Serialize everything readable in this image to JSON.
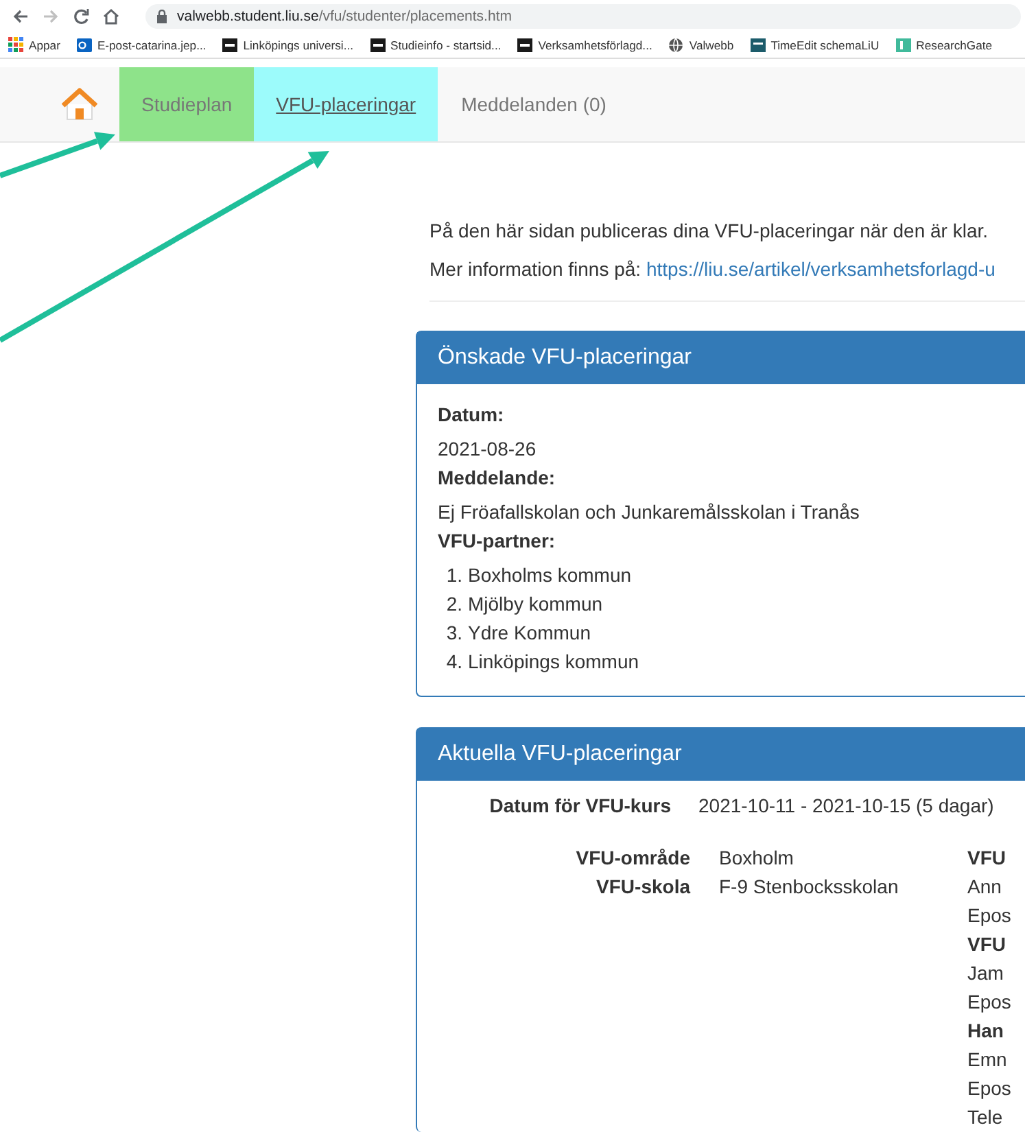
{
  "browser": {
    "url_host": "valwebb.student.liu.se",
    "url_path": "/vfu/studenter/placements.htm",
    "bookmarks": [
      {
        "label": "Appar",
        "kind": "apps"
      },
      {
        "label": "E-post-catarina.jep...",
        "kind": "mail"
      },
      {
        "label": "Linköpings universi...",
        "kind": "liu"
      },
      {
        "label": "Studieinfo - startsid...",
        "kind": "liu"
      },
      {
        "label": "Verksamhetsförlagd...",
        "kind": "liu"
      },
      {
        "label": "Valwebb",
        "kind": "globe"
      },
      {
        "label": "TimeEdit schemaLiU",
        "kind": "te"
      },
      {
        "label": "ResearchGate",
        "kind": "rg"
      }
    ]
  },
  "nav": {
    "tabs": [
      {
        "label": "Studieplan",
        "selected": false,
        "color": "#8ee38a",
        "arrow": true
      },
      {
        "label": "VFU-placeringar",
        "selected": true,
        "color": "#9cfbfb",
        "arrow": true
      },
      {
        "label": "Meddelanden (0)",
        "selected": false,
        "arrow": false
      }
    ]
  },
  "intro": {
    "text": "På den här sidan publiceras dina VFU-placeringar när den är klar.",
    "more_label": "Mer information finns på:",
    "link": "https://liu.se/artikel/verksamhetsforlagd-u"
  },
  "wish_panel": {
    "title": "Önskade VFU-placeringar",
    "date_label": "Datum:",
    "date": "2021-08-26",
    "message_label": "Meddelande:",
    "message": "Ej Fröafallskolan och Junkaremålsskolan i Tranås",
    "partner_label": "VFU-partner:",
    "partners": [
      {
        "number": "1.",
        "name": "Boxholms kommun"
      },
      {
        "number": "2.",
        "name": "Mjölby kommun"
      },
      {
        "number": "3.",
        "name": "Ydre Kommun"
      },
      {
        "number": "4.",
        "name": "Linköpings kommun"
      }
    ]
  },
  "current_panel": {
    "title": "Aktuella VFU-placeringar",
    "course_date_label": "Datum för VFU-kurs",
    "course_date": "2021-10-11 - 2021-10-15 (5 dagar)",
    "details": [
      {
        "label": "VFU-område",
        "value": "Boxholm"
      },
      {
        "label": "VFU-skola",
        "value": "F-9 Stenbocksskolan"
      }
    ],
    "contacts": [
      {
        "kind": "heading",
        "text": "VFU"
      },
      {
        "kind": "text",
        "text": "Ann"
      },
      {
        "kind": "text",
        "text": "Epos"
      },
      {
        "kind": "heading",
        "text": "VFU"
      },
      {
        "kind": "text",
        "text": "Jam"
      },
      {
        "kind": "text",
        "text": "Epos"
      },
      {
        "kind": "heading",
        "text": "Han"
      },
      {
        "kind": "text",
        "text": "Emn"
      },
      {
        "kind": "text",
        "text": "Epos"
      },
      {
        "kind": "text",
        "text": "Tele"
      }
    ]
  }
}
